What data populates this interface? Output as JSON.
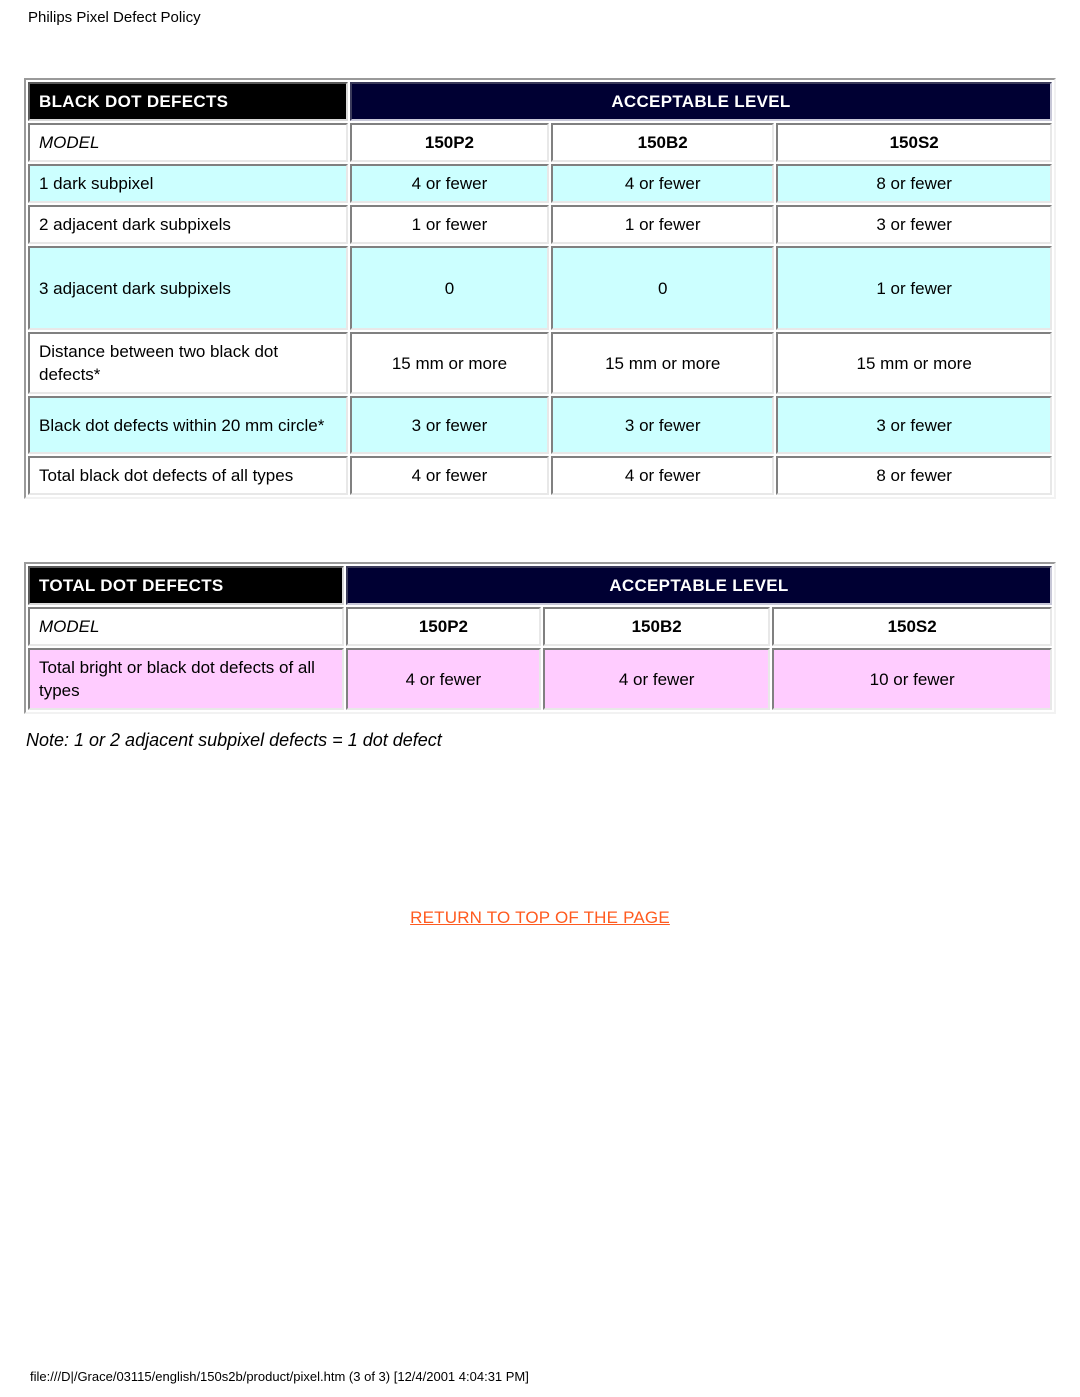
{
  "header": {
    "title": "Philips Pixel Defect Policy"
  },
  "tables": [
    {
      "id": "black-dot-defects",
      "header": {
        "category_label": "BLACK DOT DEFECTS",
        "level_label": "ACCEPTABLE LEVEL"
      },
      "model_row": {
        "label": "MODEL",
        "models": [
          "150P2",
          "150B2",
          "150S2"
        ]
      },
      "rows": [
        {
          "label": "1 dark subpixel",
          "values": [
            "4 or fewer",
            "4 or fewer",
            "8 or fewer"
          ],
          "fill": "#ccffff"
        },
        {
          "label": "2 adjacent dark subpixels",
          "values": [
            "1 or fewer",
            "1 or fewer",
            "3 or fewer"
          ],
          "fill": "#ffffff"
        },
        {
          "label": "3 adjacent dark subpixels",
          "values": [
            "0",
            "0",
            "1 or fewer"
          ],
          "fill": "#ccffff"
        },
        {
          "label": "Distance between two black dot defects*",
          "values": [
            "15 mm or more",
            "15 mm or more",
            "15 mm or more"
          ],
          "fill": "#ffffff"
        },
        {
          "label": "Black dot defects within 20 mm circle*",
          "values": [
            "3 or fewer",
            "3 or fewer",
            "3 or fewer"
          ],
          "fill": "#ccffff"
        },
        {
          "label": "Total black dot defects of all types",
          "values": [
            "4 or fewer",
            "4 or fewer",
            "8 or fewer"
          ],
          "fill": "#ffffff"
        }
      ]
    },
    {
      "id": "total-dot-defects",
      "header": {
        "category_label": "TOTAL DOT DEFECTS",
        "level_label": "ACCEPTABLE LEVEL"
      },
      "model_row": {
        "label": "MODEL",
        "models": [
          "150P2",
          "150B2",
          "150S2"
        ]
      },
      "rows": [
        {
          "label": "Total bright or black dot defects of all types",
          "values": [
            "4 or fewer",
            "4 or fewer",
            "10 or fewer"
          ],
          "fill": "#ffccff"
        }
      ]
    }
  ],
  "note": "Note: 1 or 2 adjacent subpixel defects = 1 dot defect",
  "return_link": {
    "label": "RETURN TO TOP OF THE PAGE",
    "color": "#ff5a1f"
  },
  "footer": {
    "path": "file:///D|/Grace/03115/english/150s2b/product/pixel.htm (3 of 3) [12/4/2001 4:04:31 PM]"
  },
  "colors": {
    "header_black": "#000000",
    "header_navy": "#000033",
    "cell_cyan": "#ccffff",
    "cell_white": "#ffffff",
    "cell_pink": "#ffccff",
    "link_orange": "#ff5a1f"
  }
}
